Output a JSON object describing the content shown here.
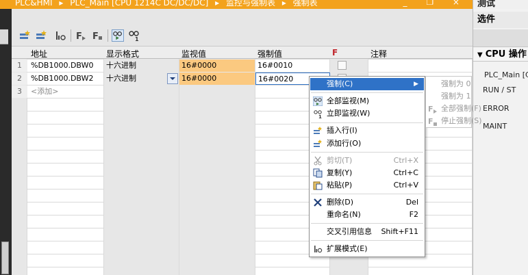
{
  "titlebar": {
    "crumbs": [
      "PLC&HMI",
      "▸",
      "PLC_Main [CPU 1214C DC/DC/DC]",
      "▸",
      "监控与强制表",
      "▸",
      "强制表"
    ],
    "buttons": "_ ❐ ×",
    "right_title": "测试"
  },
  "table": {
    "headers": {
      "address": "地址",
      "format": "显示格式",
      "monitor": "监视值",
      "force": "强制值",
      "f": "F",
      "comment": "注释"
    },
    "rows": [
      {
        "num": "1",
        "address": "%DB1000.DBW0",
        "format": "十六进制",
        "monitor": "16#0000",
        "force": "16#0010"
      },
      {
        "num": "2",
        "address": "%DB1000.DBW2",
        "format": "十六进制",
        "monitor": "16#0000",
        "force": "16#0020"
      },
      {
        "num": "3",
        "address": "<添加>"
      }
    ]
  },
  "rightpane": {
    "options": "选件",
    "cpu_ops": "CPU 操作",
    "plc": "PLC_Main [C",
    "run": "RUN / ST",
    "error": "ERROR",
    "maint": "MAINT"
  },
  "menu": {
    "items": [
      {
        "label": "强制(C)",
        "shortcut": ""
      },
      {
        "label": "全部监视(M)",
        "shortcut": ""
      },
      {
        "label": "立即监视(W)",
        "shortcut": ""
      },
      {
        "label": "插入行(I)",
        "shortcut": ""
      },
      {
        "label": "添加行(O)",
        "shortcut": ""
      },
      {
        "label": "剪切(T)",
        "shortcut": "Ctrl+X"
      },
      {
        "label": "复制(Y)",
        "shortcut": "Ctrl+C"
      },
      {
        "label": "粘贴(P)",
        "shortcut": "Ctrl+V"
      },
      {
        "label": "删除(D)",
        "shortcut": "Del"
      },
      {
        "label": "重命名(N)",
        "shortcut": "F2"
      },
      {
        "label": "交叉引用信息",
        "shortcut": "Shift+F11"
      },
      {
        "label": "扩展模式(E)",
        "shortcut": ""
      }
    ],
    "submenu": [
      "强制为 0",
      "强制为 1",
      "全部强制(F)",
      "停止强制(S)"
    ]
  },
  "colors": {
    "accent": "#f3a21c",
    "selection": "#2f72c7",
    "monitor_cell": "#fbc980"
  }
}
